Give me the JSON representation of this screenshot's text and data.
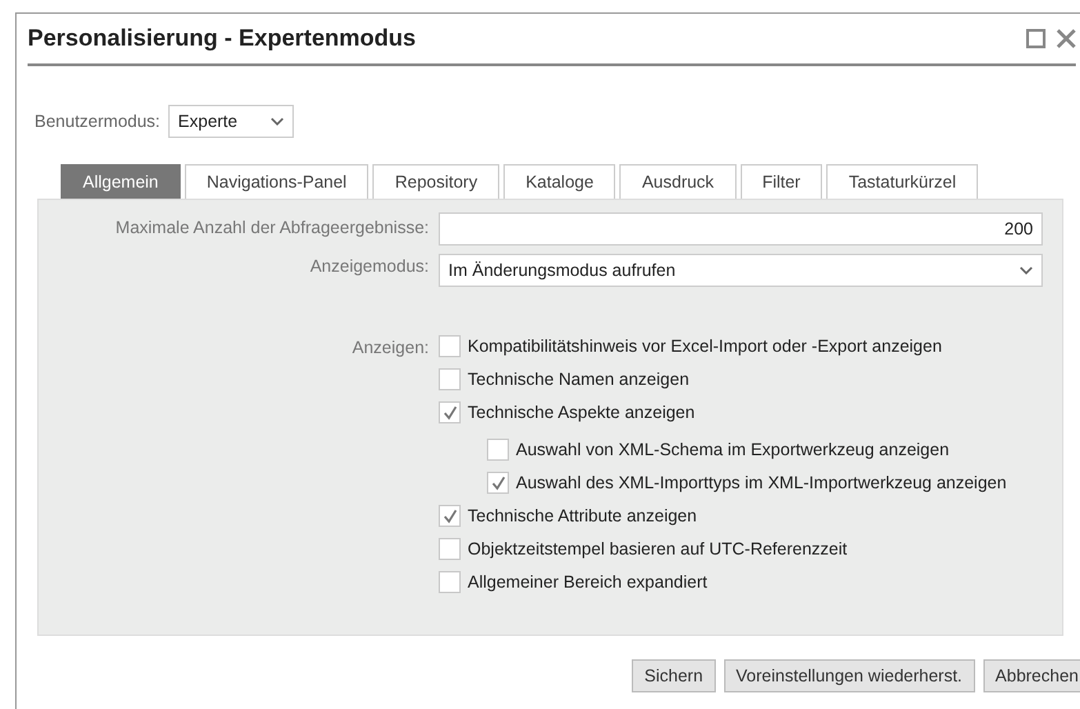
{
  "window": {
    "title": "Personalisierung - Expertenmodus"
  },
  "user_mode": {
    "label": "Benutzermodus:",
    "value": "Experte"
  },
  "tabs": [
    {
      "label": "Allgemein",
      "selected": true
    },
    {
      "label": "Navigations-Panel",
      "selected": false
    },
    {
      "label": "Repository",
      "selected": false
    },
    {
      "label": "Kataloge",
      "selected": false
    },
    {
      "label": "Ausdruck",
      "selected": false
    },
    {
      "label": "Filter",
      "selected": false
    },
    {
      "label": "Tastaturkürzel",
      "selected": false
    }
  ],
  "max_results": {
    "label": "Maximale Anzahl der Abfrageergebnisse:",
    "value": "200"
  },
  "display_mode": {
    "label": "Anzeigemodus:",
    "value": "Im Änderungsmodus aufrufen"
  },
  "show": {
    "label": "Anzeigen:",
    "options": [
      {
        "label": "Kompatibilitätshinweis vor Excel-Import oder -Export anzeigen",
        "checked": false
      },
      {
        "label": "Technische Namen anzeigen",
        "checked": false
      },
      {
        "label": "Technische Aspekte anzeigen",
        "checked": true,
        "children": [
          {
            "label": "Auswahl von XML-Schema im Exportwerkzeug anzeigen",
            "checked": false
          },
          {
            "label": "Auswahl des XML-Importtyps im XML-Importwerkzeug anzeigen",
            "checked": true
          }
        ]
      },
      {
        "label": "Technische Attribute anzeigen",
        "checked": true
      },
      {
        "label": "Objektzeitstempel basieren auf UTC-Referenzzeit",
        "checked": false
      },
      {
        "label": "Allgemeiner Bereich expandiert",
        "checked": false
      }
    ]
  },
  "buttons": [
    "Sichern",
    "Voreinstellungen wiederherst.",
    "Abbrechen"
  ]
}
